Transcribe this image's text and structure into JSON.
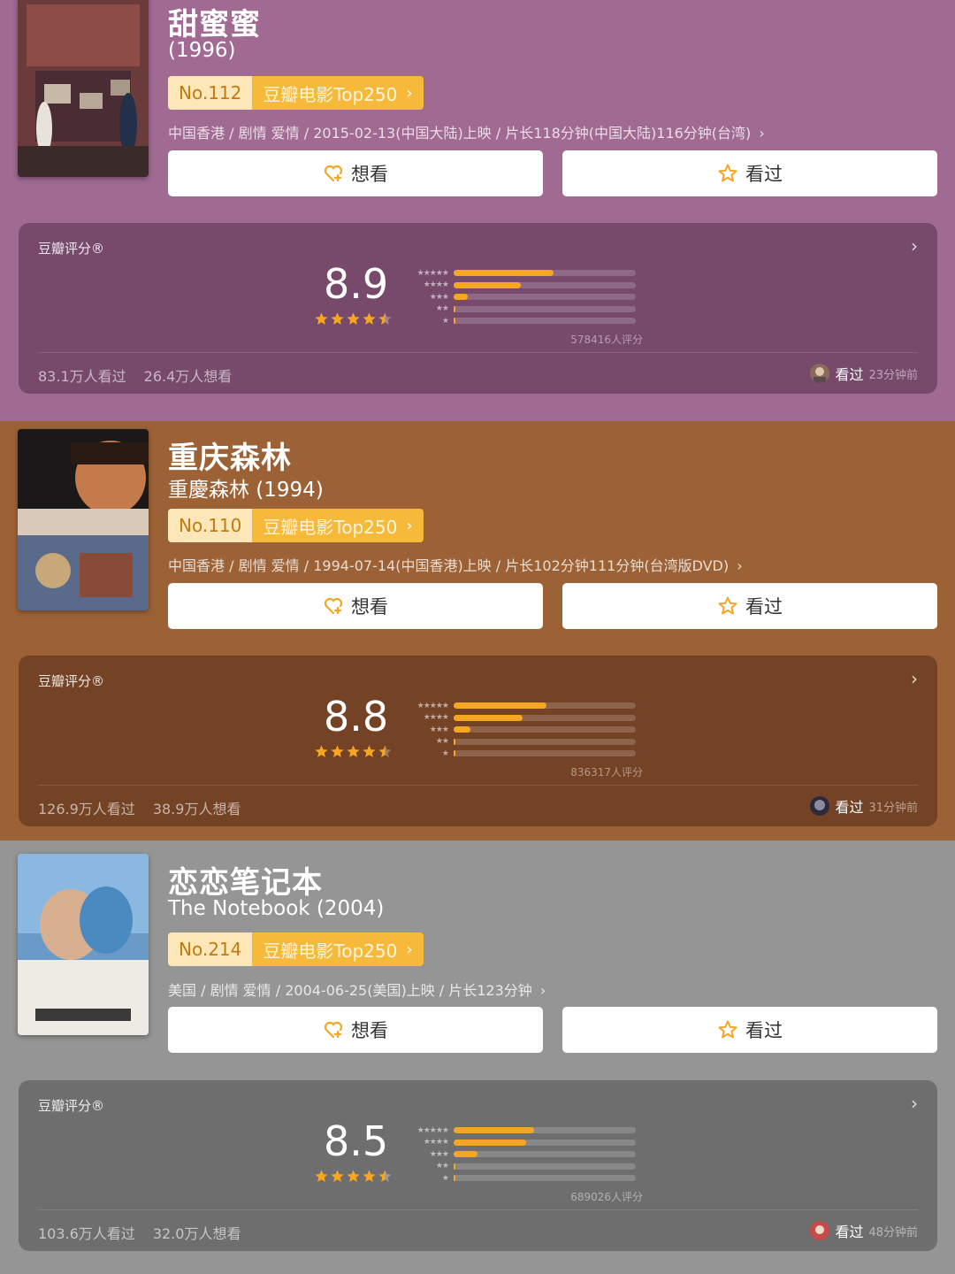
{
  "movies": [
    {
      "title": "甜蜜蜜",
      "subtitle": "(1996)",
      "rank_no": "No.112",
      "rank_list": "豆瓣电影Top250",
      "meta": "中国香港 / 剧情 爱情 / 2015-02-13(中国大陆)上映 / 片长118分钟(中国大陆)116分钟(台湾)",
      "want_label": "想看",
      "seen_label": "看过",
      "rating_label": "豆瓣评分®",
      "score": "8.9",
      "distribution": [
        0.55,
        0.37,
        0.08,
        0.01,
        0.005
      ],
      "votes": "578416人评分",
      "watched": "83.1万人看过",
      "wants": "26.4万人想看",
      "recent_action": "看过",
      "recent_time": "23分钟前"
    },
    {
      "title": "重庆森林",
      "subtitle": "重慶森林 (1994)",
      "rank_no": "No.110",
      "rank_list": "豆瓣电影Top250",
      "meta": "中国香港 / 剧情 爱情 / 1994-07-14(中国香港)上映 / 片长102分钟111分钟(台湾版DVD)",
      "want_label": "想看",
      "seen_label": "看过",
      "rating_label": "豆瓣评分®",
      "score": "8.8",
      "distribution": [
        0.51,
        0.38,
        0.09,
        0.01,
        0.005
      ],
      "votes": "836317人评分",
      "watched": "126.9万人看过",
      "wants": "38.9万人想看",
      "recent_action": "看过",
      "recent_time": "31分钟前"
    },
    {
      "title": "恋恋笔记本",
      "subtitle": "The Notebook (2004)",
      "rank_no": "No.214",
      "rank_list": "豆瓣电影Top250",
      "meta": "美国 / 剧情 爱情 / 2004-06-25(美国)上映 / 片长123分钟",
      "want_label": "想看",
      "seen_label": "看过",
      "rating_label": "豆瓣评分®",
      "score": "8.5",
      "distribution": [
        0.44,
        0.4,
        0.13,
        0.01,
        0.005
      ],
      "votes": "689026人评分",
      "watched": "103.6万人看过",
      "wants": "32.0万人想看",
      "recent_action": "看过",
      "recent_time": "48分钟前"
    }
  ],
  "colors": {
    "accent_orange": "#f5a623",
    "rank_tag": "#f7b93a",
    "section_1": "#a06a92",
    "section_2": "#9c6236",
    "section_3": "#959595"
  },
  "icons": {
    "want": "heart-plus-icon",
    "seen": "star-outline-icon",
    "chevron": "chevron-right-icon"
  }
}
